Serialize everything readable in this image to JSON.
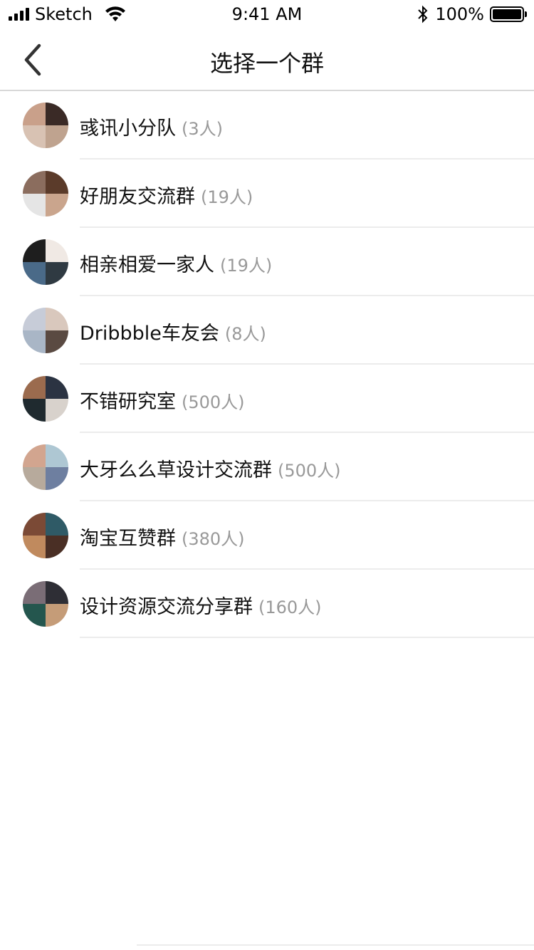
{
  "status_bar": {
    "carrier": "Sketch",
    "time": "9:41 AM",
    "battery": "100%"
  },
  "nav": {
    "title": "选择一个群",
    "back_icon": "chevron-left-icon"
  },
  "groups": [
    {
      "name": "彧讯小分队",
      "count": "(3人)",
      "avatar_colors": [
        "#c9a08a",
        "#3a2a26",
        "#d8c2b3",
        "#bfa38f"
      ]
    },
    {
      "name": "好朋友交流群",
      "count": "(19人)",
      "avatar_colors": [
        "#8b6d5e",
        "#5b3b2a",
        "#e5e5e5",
        "#caa58d"
      ]
    },
    {
      "name": "相亲相爱一家人",
      "count": "(19人)",
      "avatar_colors": [
        "#1e1e1e",
        "#f0e9e4",
        "#4a6a88",
        "#2f3a42"
      ]
    },
    {
      "name": "Dribbble车友会",
      "count": "(8人)",
      "avatar_colors": [
        "#c7ccd8",
        "#d9c8bd",
        "#a9b6c6",
        "#5a4a42"
      ]
    },
    {
      "name": "不错研究室",
      "count": "(500人)",
      "avatar_colors": [
        "#9b6b4e",
        "#2b3342",
        "#1f2a2f",
        "#d8d2cc"
      ]
    },
    {
      "name": "大牙么么草设计交流群",
      "count": "(500人)",
      "avatar_colors": [
        "#d2a58f",
        "#aec7d3",
        "#b7aa9c",
        "#6e7fa0"
      ]
    },
    {
      "name": "淘宝互赞群",
      "count": "(380人)",
      "avatar_colors": [
        "#7b4a36",
        "#2f5a66",
        "#c08a5e",
        "#4a2f25"
      ]
    },
    {
      "name": "设计资源交流分享群",
      "count": "(160人)",
      "avatar_colors": [
        "#7a6d76",
        "#2e2e35",
        "#24564e",
        "#c59c78"
      ]
    }
  ]
}
